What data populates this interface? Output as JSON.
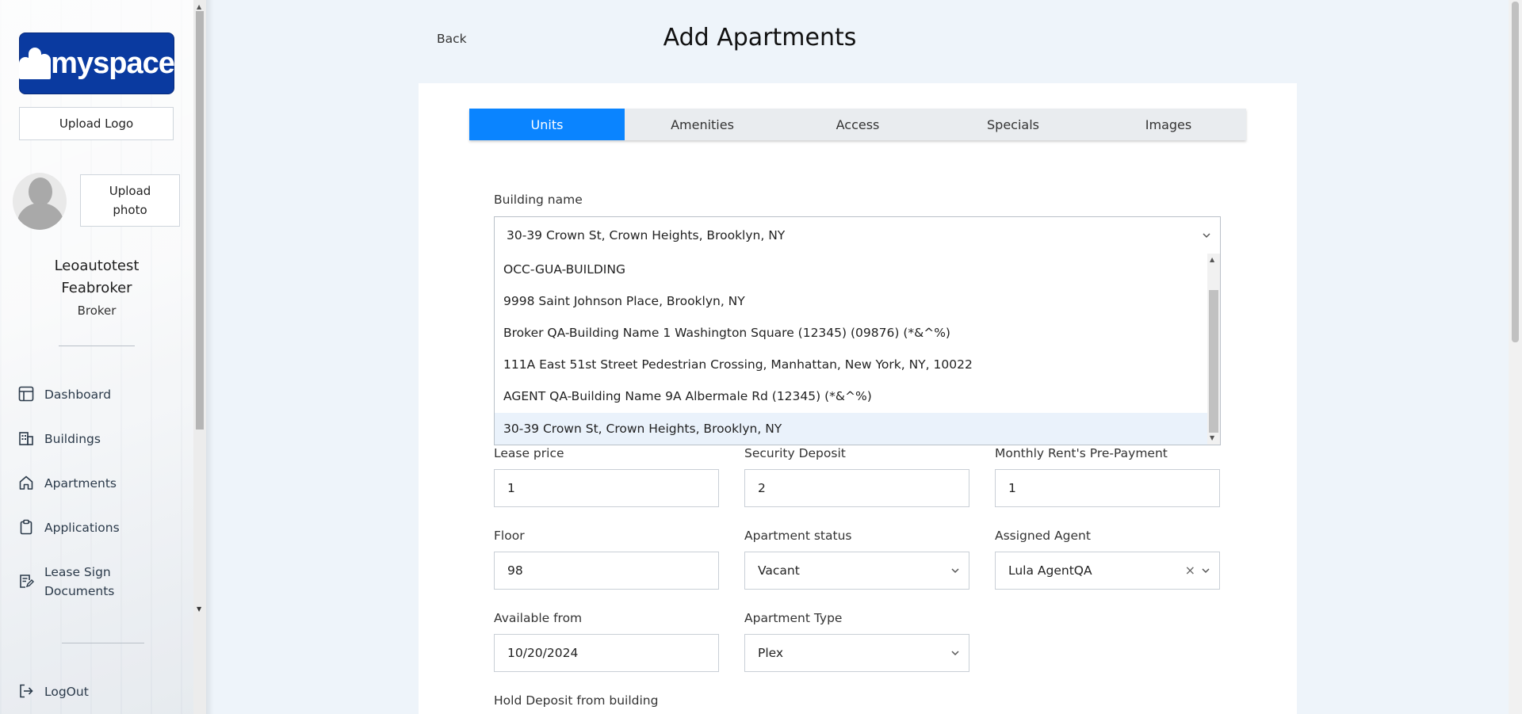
{
  "sidebar": {
    "logo_text": "myspace",
    "upload_logo": "Upload Logo",
    "upload_photo_line1": "Upload",
    "upload_photo_line2": "photo",
    "user_first": "Leoautotest",
    "user_last": "Feabroker",
    "role": "Broker",
    "nav": {
      "dashboard": "Dashboard",
      "buildings": "Buildings",
      "apartments": "Apartments",
      "applications": "Applications",
      "lease_line1": "Lease Sign",
      "lease_line2": "Documents",
      "logout": "LogOut"
    }
  },
  "header": {
    "back": "Back",
    "title": "Add Apartments"
  },
  "tabs": {
    "units": "Units",
    "amenities": "Amenities",
    "access": "Access",
    "specials": "Specials",
    "images": "Images"
  },
  "form": {
    "building_label": "Building name",
    "building_value": "30-39 Crown St, Crown Heights, Brooklyn, NY",
    "building_options": [
      "OCC-GUA-BUILDING",
      "9998 Saint Johnson Place, Brooklyn, NY",
      "Broker QA-Building Name 1 Washington Square (12345) (09876) (*&^%)",
      "111A East 51st Street Pedestrian Crossing, Manhattan, New York, NY, 10022",
      "AGENT QA-Building Name 9A Albermale Rd (12345) (*&^%)",
      "30-39 Crown St, Crown Heights, Brooklyn, NY"
    ],
    "lease_price_label": "Lease price",
    "lease_price_value": "1",
    "security_deposit_label": "Security Deposit",
    "security_deposit_value": "2",
    "prepayment_label": "Monthly Rent's Pre-Payment",
    "prepayment_value": "1",
    "floor_label": "Floor",
    "floor_value": "98",
    "status_label": "Apartment status",
    "status_value": "Vacant",
    "agent_label": "Assigned Agent",
    "agent_value": "Lula AgentQA",
    "available_label": "Available from",
    "available_value": "10/20/2024",
    "type_label": "Apartment Type",
    "type_value": "Plex",
    "hold_deposit_label": "Hold Deposit from building"
  },
  "colors": {
    "accent": "#0a84ff",
    "logo_bg": "#0a3aa0",
    "page_bg": "#eef4fa"
  },
  "icons": [
    "dashboard-icon",
    "buildings-icon",
    "home-icon",
    "clipboard-icon",
    "document-edit-icon",
    "logout-icon",
    "chevron-down-icon",
    "close-icon"
  ]
}
